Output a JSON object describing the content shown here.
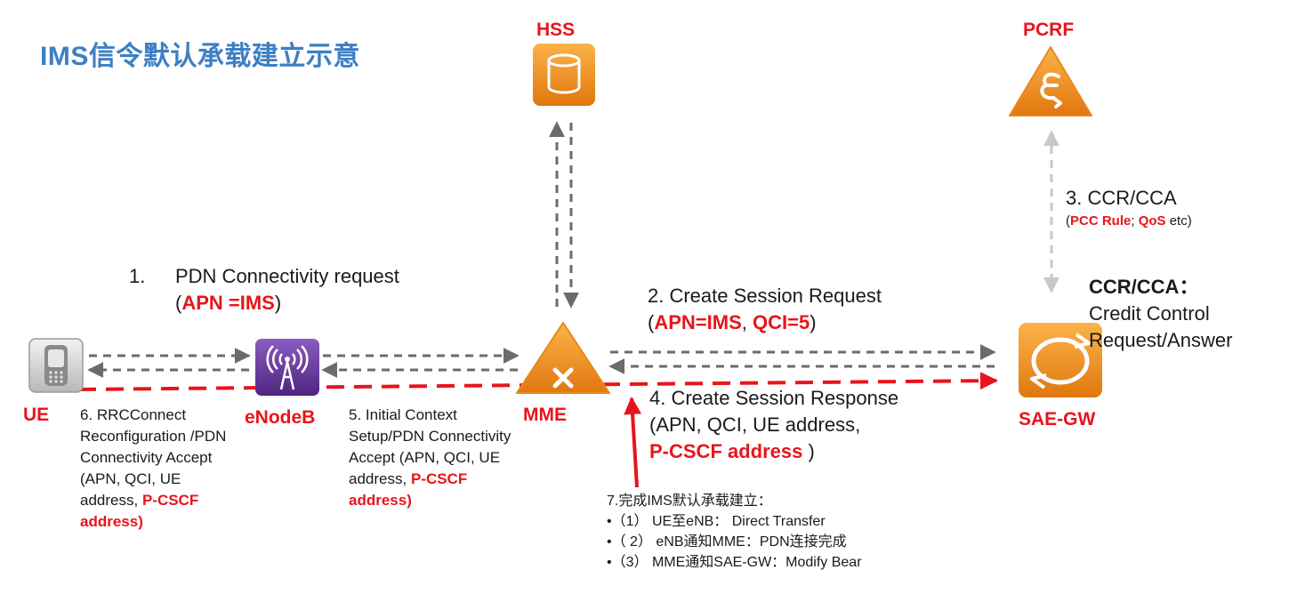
{
  "title": "IMS信令默认承载建立示意",
  "nodes": {
    "ue": "UE",
    "enodeb": "eNodeB",
    "mme": "MME",
    "hss": "HSS",
    "pcrf": "PCRF",
    "saegw": "SAE-GW"
  },
  "step1": {
    "num": "1.",
    "line1": "PDN Connectivity request",
    "paren_open": "(",
    "apn": "APN =IMS",
    "paren_close": ")"
  },
  "step2": {
    "line1": "2. Create Session Request",
    "paren_open": "(",
    "apn": "APN=IMS",
    "sep": ", ",
    "qci": "QCI=5",
    "paren_close": ")"
  },
  "step3": {
    "line1": "3. CCR/CCA",
    "paren_open": "(",
    "pcc": "PCC Rule",
    "semi": "; ",
    "qos": "QoS",
    "etc": " etc)"
  },
  "ccr_note": {
    "heading": "CCR/CCA：",
    "line2": "Credit Control",
    "line3": "Request/Answer"
  },
  "step4": {
    "line1": "4. Create Session Response",
    "line2": "(APN, QCI, UE address,",
    "red": "P-CSCF address",
    "close": " )"
  },
  "step5": {
    "line1": "5. Initial Context",
    "line2": "Setup/PDN Connectivity",
    "line3": "Accept (APN, QCI, UE",
    "line4a": "address, ",
    "line4red": "P-CSCF",
    "line5red": "address)"
  },
  "step6": {
    "line1": "6. RRCConnect",
    "line2": "Reconfiguration /PDN",
    "line3": "Connectivity Accept",
    "line4": "(APN, QCI, UE",
    "line5a": "address, ",
    "line5red": "P-CSCF",
    "line6red": "address)"
  },
  "step7": {
    "heading": "7.完成IMS默认承载建立：",
    "items": [
      "•（1） UE至eNB： Direct Transfer",
      "•（ 2） eNB通知MME：PDN连接完成",
      "•（3） MME通知SAE-GW：Modify Bear"
    ]
  },
  "colors": {
    "title": "#3d7fc4",
    "red": "#e8141b",
    "orange": "#f39a1e",
    "purple": "#6b3fa0",
    "arrow_gray": "#6b6b6b",
    "arrow_light": "#c8c8c8"
  }
}
